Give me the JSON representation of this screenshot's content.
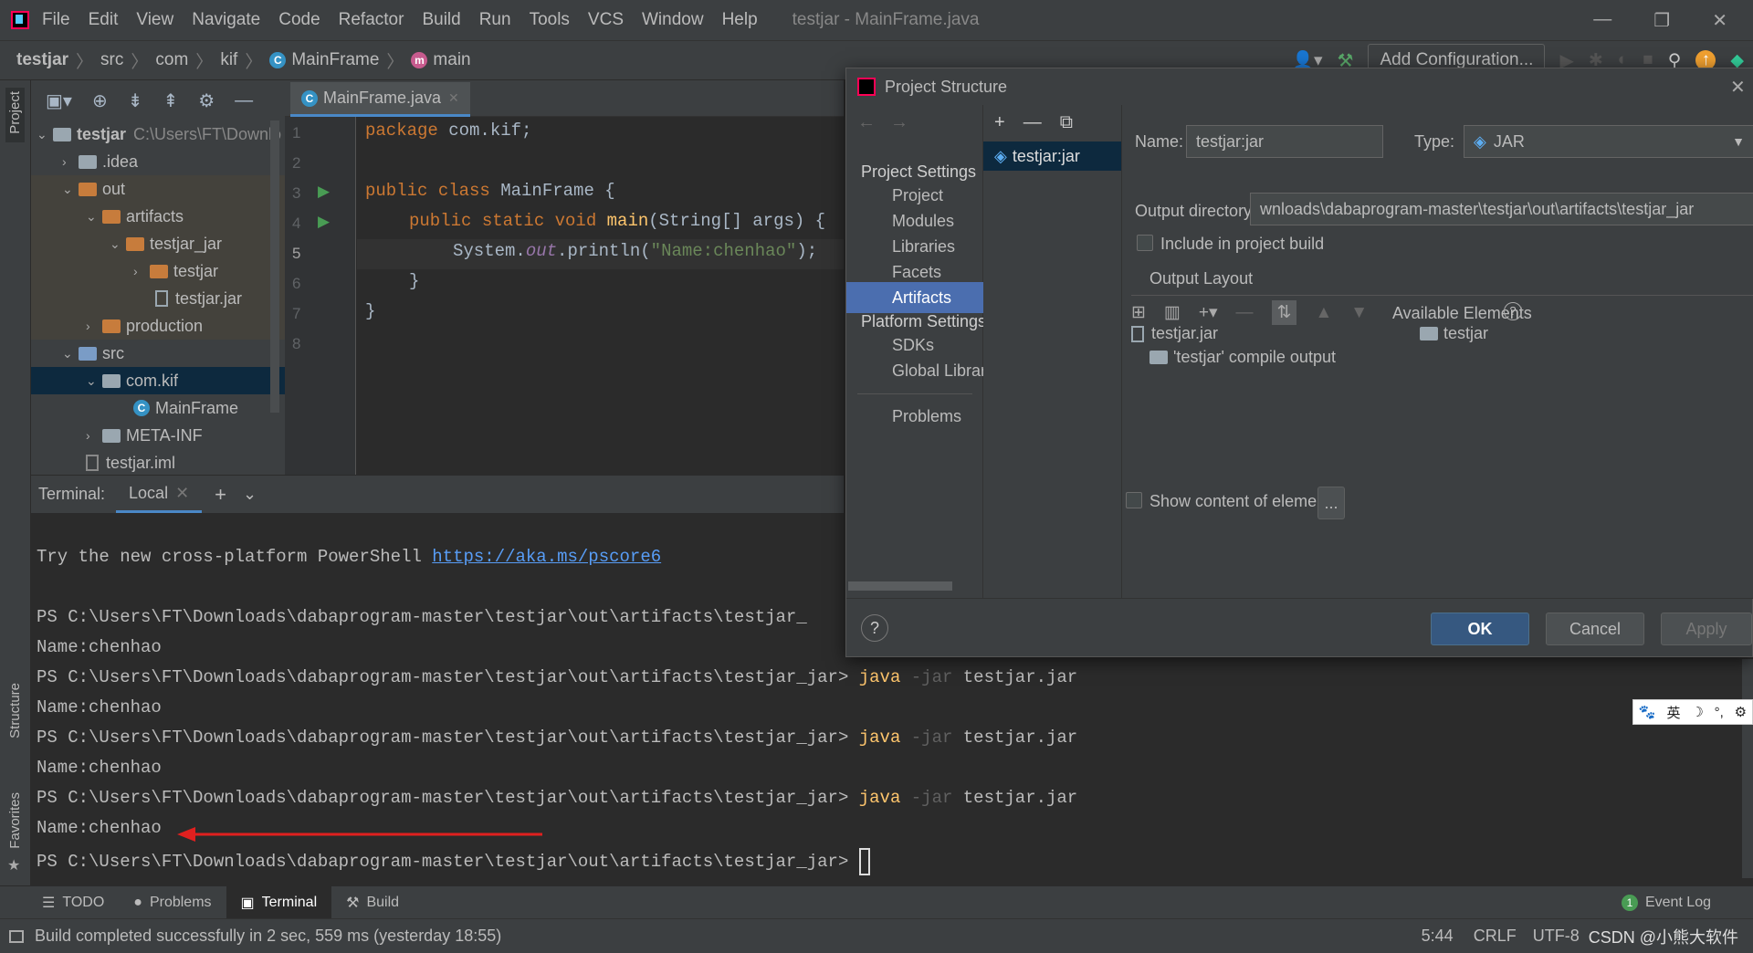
{
  "window": {
    "title": "testjar - MainFrame.java"
  },
  "menu": [
    "File",
    "Edit",
    "View",
    "Navigate",
    "Code",
    "Refactor",
    "Build",
    "Run",
    "Tools",
    "VCS",
    "Window",
    "Help"
  ],
  "breadcrumb": {
    "project": "testjar",
    "p1": "src",
    "p2": "com",
    "p3": "kif",
    "p4": "MainFrame",
    "p5": "main"
  },
  "toolbar": {
    "add_config": "Add Configuration..."
  },
  "side": {
    "project": "Project",
    "structure": "Structure",
    "favorites": "Favorites"
  },
  "tree": {
    "root_name": "testjar",
    "root_path": "C:\\Users\\FT\\Downlo",
    "items": [
      "testjar",
      ".idea",
      "out",
      "artifacts",
      "testjar_jar",
      "testjar",
      "testjar.jar",
      "production",
      "src",
      "com.kif",
      "MainFrame",
      "META-INF",
      "testjar.iml"
    ]
  },
  "editor": {
    "tab": "MainFrame.java",
    "line_numbers": [
      "1",
      "2",
      "3",
      "4",
      "5",
      "6",
      "7",
      "8"
    ],
    "code": {
      "l1_kw": "package",
      "l1_rest": " com.kif;",
      "l3_kw": "public class",
      "l3_rest": " MainFrame {",
      "l4_kw": "public static void",
      "l4_fn": " main",
      "l4_rest": "(String[] args) {",
      "l5_a": "System.",
      "l5_out": "out",
      "l5_b": ".println(",
      "l5_str": "\"Name:chenhao\"",
      "l5_c": ");",
      "l6": "}",
      "l7": "}"
    }
  },
  "terminal": {
    "label": "Terminal:",
    "tab": "Local",
    "ps_hint": "Try the new cross-platform PowerShell ",
    "ps_link": "https://aka.ms/pscore6",
    "prompt_short": "PS C:\\Users\\FT\\Downloads\\dabaprogram-master\\testjar\\out\\artifacts\\testjar_",
    "prompt": "PS C:\\Users\\FT\\Downloads\\dabaprogram-master\\testjar\\out\\artifacts\\testjar_jar> ",
    "cmd_java": "java",
    "cmd_flag": " -jar",
    "cmd_file": " testjar.jar",
    "output": "Name:chenhao"
  },
  "bottom_tabs": [
    "TODO",
    "Problems",
    "Terminal",
    "Build"
  ],
  "event_log": {
    "count": "1",
    "label": "Event Log"
  },
  "status": {
    "message": "Build completed successfully in 2 sec, 559 ms (yesterday 18:55)",
    "pos": "5:44",
    "eol": "CRLF",
    "enc": "UTF-8",
    "watermark": "CSDN @小熊大软件"
  },
  "dialog": {
    "title": "Project Structure",
    "nav": {
      "project_settings": "Project Settings",
      "project": "Project",
      "modules": "Modules",
      "libraries": "Libraries",
      "facets": "Facets",
      "artifacts": "Artifacts",
      "platform_settings": "Platform Settings",
      "sdks": "SDKs",
      "global_libraries": "Global Librar",
      "problems": "Problems"
    },
    "artifact": "testjar:jar",
    "name_label": "Name:",
    "name_value": "testjar:jar",
    "type_label": "Type:",
    "type_value": "JAR",
    "output_dir_label": "Output directory:",
    "output_dir_value": "wnloads\\dabaprogram-master\\testjar\\out\\artifacts\\testjar_jar",
    "include_build": "Include in project build",
    "output_layout": "Output Layout",
    "available_elements": "Available Elements",
    "layout_items": [
      "testjar.jar",
      "'testjar' compile output"
    ],
    "available_items": [
      "testjar"
    ],
    "show_content": "Show content of elements",
    "ellipsis": "...",
    "ok": "OK",
    "cancel": "Cancel",
    "apply": "Apply",
    "help": "?"
  },
  "ime": {
    "lang": "英"
  }
}
